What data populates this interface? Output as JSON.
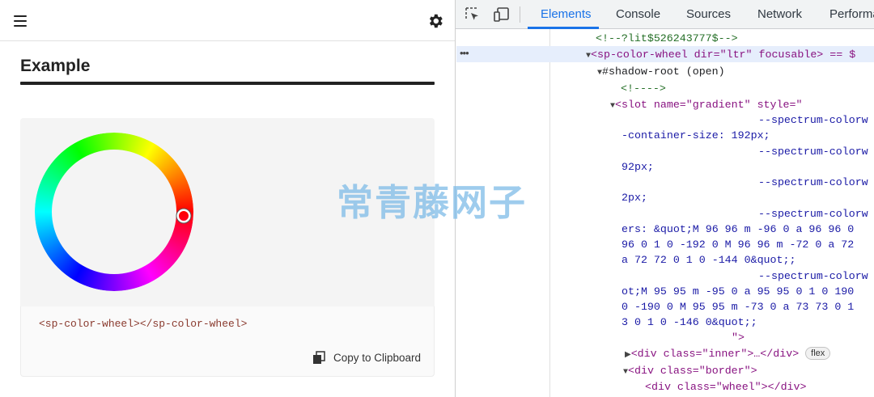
{
  "left": {
    "example_title": "Example",
    "code_snippet": "<sp-color-wheel></sp-color-wheel>",
    "copy_label": "Copy to Clipboard"
  },
  "devtools": {
    "tabs": [
      "Elements",
      "Console",
      "Sources",
      "Network",
      "Performa"
    ],
    "active_tab": "Elements",
    "dots": "•••",
    "lines": [
      {
        "text": "<!--?lit$526243777$-->"
      },
      {
        "text": "<sp-color-wheel dir=\"ltr\" focusable> == $"
      },
      {
        "text": "#shadow-root (open)"
      },
      {
        "text": "<!---->"
      },
      {
        "text": "<slot name=\"gradient\" style=\""
      },
      {
        "text": "--spectrum-colorw"
      },
      {
        "text": "-container-size: 192px;"
      },
      {
        "text": "--spectrum-colorw"
      },
      {
        "text": "92px;"
      },
      {
        "text": "--spectrum-colorw"
      },
      {
        "text": "2px;"
      },
      {
        "text": "--spectrum-colorw"
      },
      {
        "text": "ers: &quot;M 96 96 m -96 0 a 96 96 0"
      },
      {
        "text": "96 0 1 0 -192 0 M 96 96 m -72 0 a 72"
      },
      {
        "text": "a 72 72 0 1 0 -144 0&quot;;"
      },
      {
        "text": "--spectrum-colorw"
      },
      {
        "text": "ot;M 95 95 m -95 0 a 95 95 0 1 0 190"
      },
      {
        "text": "0 -190 0 M 95 95 m -73 0 a 73 73 0 1"
      },
      {
        "text": "3 0 1 0 -146 0&quot;;"
      },
      {
        "text": "\">"
      },
      {
        "text": "<div class=\"inner\">…</div>"
      },
      {
        "text": "flex"
      },
      {
        "text": "<div class=\"border\">"
      },
      {
        "text": "<div class=\"wheel\"></div>"
      }
    ]
  },
  "watermark": "常青藤网子",
  "colors": {
    "accent": "#1a73e8",
    "tag": "#881280",
    "attribute": "#994500",
    "value": "#1a1aa6",
    "comment": "#236e25"
  },
  "icons": [
    "hamburger-menu-icon",
    "gear-icon",
    "copy-icon",
    "inspect-element-icon",
    "device-toolbar-icon"
  ]
}
